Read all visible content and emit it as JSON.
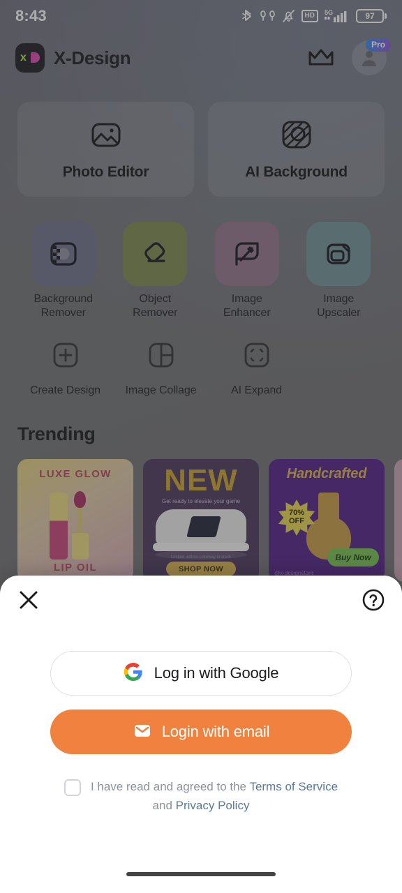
{
  "statusbar": {
    "time": "8:43",
    "battery_percent": "97",
    "hd_label": "HD",
    "network_label": "5G",
    "icons": [
      "bluetooth-icon",
      "earbuds-icon",
      "mute-bell-icon",
      "hd-icon",
      "signal-5g-icon",
      "battery-icon"
    ]
  },
  "header": {
    "app_name": "X-Design",
    "logo_x": "x",
    "pro_badge": "Pro"
  },
  "hero": {
    "cards": [
      {
        "label": "Photo Editor",
        "icon": "photo-icon"
      },
      {
        "label": "AI Background",
        "icon": "ai-background-icon"
      }
    ]
  },
  "tools": {
    "row1": [
      {
        "label": "Background\nRemover",
        "label_l1": "Background",
        "label_l2": "Remover",
        "color": "#6c6d87",
        "icon": "background-remover-icon"
      },
      {
        "label": "Object Remover",
        "label_l1": "Object",
        "label_l2": "Remover",
        "color": "#7b8749",
        "icon": "eraser-icon"
      },
      {
        "label": "Image Enhancer",
        "label_l1": "Image",
        "label_l2": "Enhancer",
        "color": "#93738a",
        "icon": "magic-wand-icon"
      },
      {
        "label": "Image Upscaler",
        "label_l1": "Image",
        "label_l2": "Upscaler",
        "color": "#6f9195",
        "icon": "upscale-icon"
      }
    ],
    "row2": [
      {
        "label": "Create Design",
        "icon": "plus-square-icon"
      },
      {
        "label": "Image Collage",
        "icon": "collage-icon"
      },
      {
        "label": "AI Expand",
        "icon": "ai-expand-icon"
      }
    ]
  },
  "trending": {
    "title": "Trending",
    "cards": [
      {
        "name": "luxe-glow-lip-oil",
        "top_text": "LUXE GLOW",
        "bottom_text": "LIP OIL"
      },
      {
        "name": "new-sneaker",
        "headline": "NEW",
        "subtitle": "Get ready to elevate your game",
        "fineprint": "Limited edition colorway in stock",
        "button": "SHOP NOW"
      },
      {
        "name": "handcrafted-vase",
        "headline": "Handcrafted",
        "badge_line1": "70%",
        "badge_line2": "OFF",
        "button": "Buy Now",
        "handle": "@x-designstore"
      },
      {
        "name": "partial-card"
      }
    ]
  },
  "modal": {
    "close_icon": "close-icon",
    "help_icon": "help-circle-icon",
    "google_button": "Log in with Google",
    "email_button": "Login with email",
    "terms_prefix": "I have read and agreed to the ",
    "terms_link": "Terms of Service",
    "terms_middle": "and ",
    "privacy_link": "Privacy Policy"
  },
  "colors": {
    "accent_orange": "#f0813f",
    "link_blue": "#5b7a95",
    "pro_gradient_start": "#2e8ae6",
    "pro_gradient_end": "#8b4fd6"
  }
}
